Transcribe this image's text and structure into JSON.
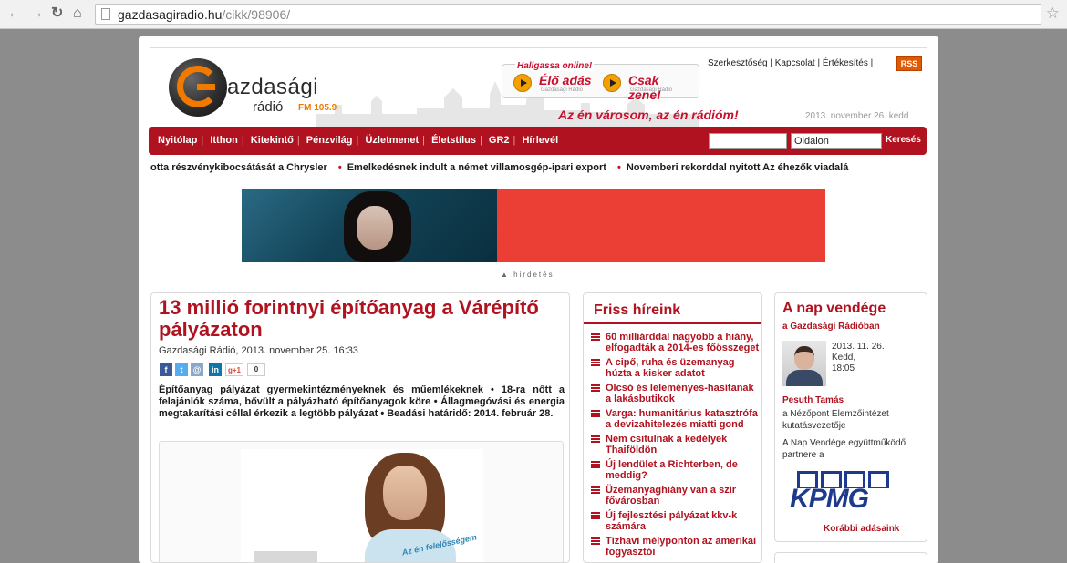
{
  "browser": {
    "url_host": "gazdasagiradio.hu",
    "url_path": "/cikk/98906/"
  },
  "site": {
    "logo_name": "azdasági",
    "logo_sub": "rádió",
    "logo_fm": "FM 105.9",
    "listen_header": "Hallgassa online!",
    "live_label": "Élő adás",
    "live_sub": "Gazdasági Rádió",
    "music_label": "Csak zene!",
    "music_sub": "Gazdasági Rádió",
    "slogan": "Az én városom, az én rádióm!",
    "top_links": [
      "Szerkesztőség",
      "Kapcsolat",
      "Értékesítés"
    ],
    "rss": "RSS",
    "date": "2013. november 26. kedd"
  },
  "menu": {
    "items": [
      "Nyitólap",
      "Itthon",
      "Kitekintő",
      "Pénzvilág",
      "Üzletmenet",
      "Életstílus",
      "GR2",
      "Hírlevél"
    ],
    "search_scope": "Oldalon",
    "search_button": "Keresés"
  },
  "ticker": [
    "otta részvénykibocsátását a Chrysler",
    "Emelkedésnek indult a német villamosgép-ipari export",
    "Novemberi rekorddal nyitott Az éhezők viadalá"
  ],
  "ad": {
    "label": "▲ hirdetés"
  },
  "article": {
    "title": "13 millió forintnyi építőanyag a Várépítő pályázaton",
    "meta": "Gazdasági Rádió, 2013. november 25. 16:33",
    "share_count": "0",
    "lead": "Építőanyag pályázat gyermekintézményeknek és műemlékeknek • 18-ra nőtt a felajánlók száma, bővült a pályázható építőanyagok köre • Állagmegóvási és energia megtakarítási céllal érkezik a legtöbb pályázat • Beadási határidő: 2014. február 28.",
    "image_shirt_text": "Az én felelősségem"
  },
  "news": {
    "title": "Friss híreink",
    "items": [
      "60 milliárddal nagyobb a hiány, elfogadták a 2014-es főösszeget",
      "A cipő, ruha és üzemanyag húzta a kisker adatot",
      "Olcsó és leleményes-hasítanak a lakásbutikok",
      "Varga: humanitárius katasztrófa a devizahitelezés miatti gond",
      "Nem csitulnak a kedélyek Thaiföldön",
      "Új lendület a Richterben, de meddig?",
      "Üzemanyaghiány van a szír fővárosban",
      "Új fejlesztési pályázat kkv-k számára",
      "Tízhavi mélyponton az amerikai fogyasztói"
    ]
  },
  "guest": {
    "title": "A nap vendége",
    "subtitle": "a Gazdasági Rádióban",
    "date": "2013. 11. 26.",
    "weekday": "Kedd,",
    "time": "18:05",
    "name": "Pesuth Tamás",
    "role": "a Nézőpont Elemzőintézet kutatásvezetője",
    "partner": "A Nap Vendége együttműködő partnere a",
    "partner_logo": "KPMG",
    "more": "Korábbi adásaink"
  }
}
